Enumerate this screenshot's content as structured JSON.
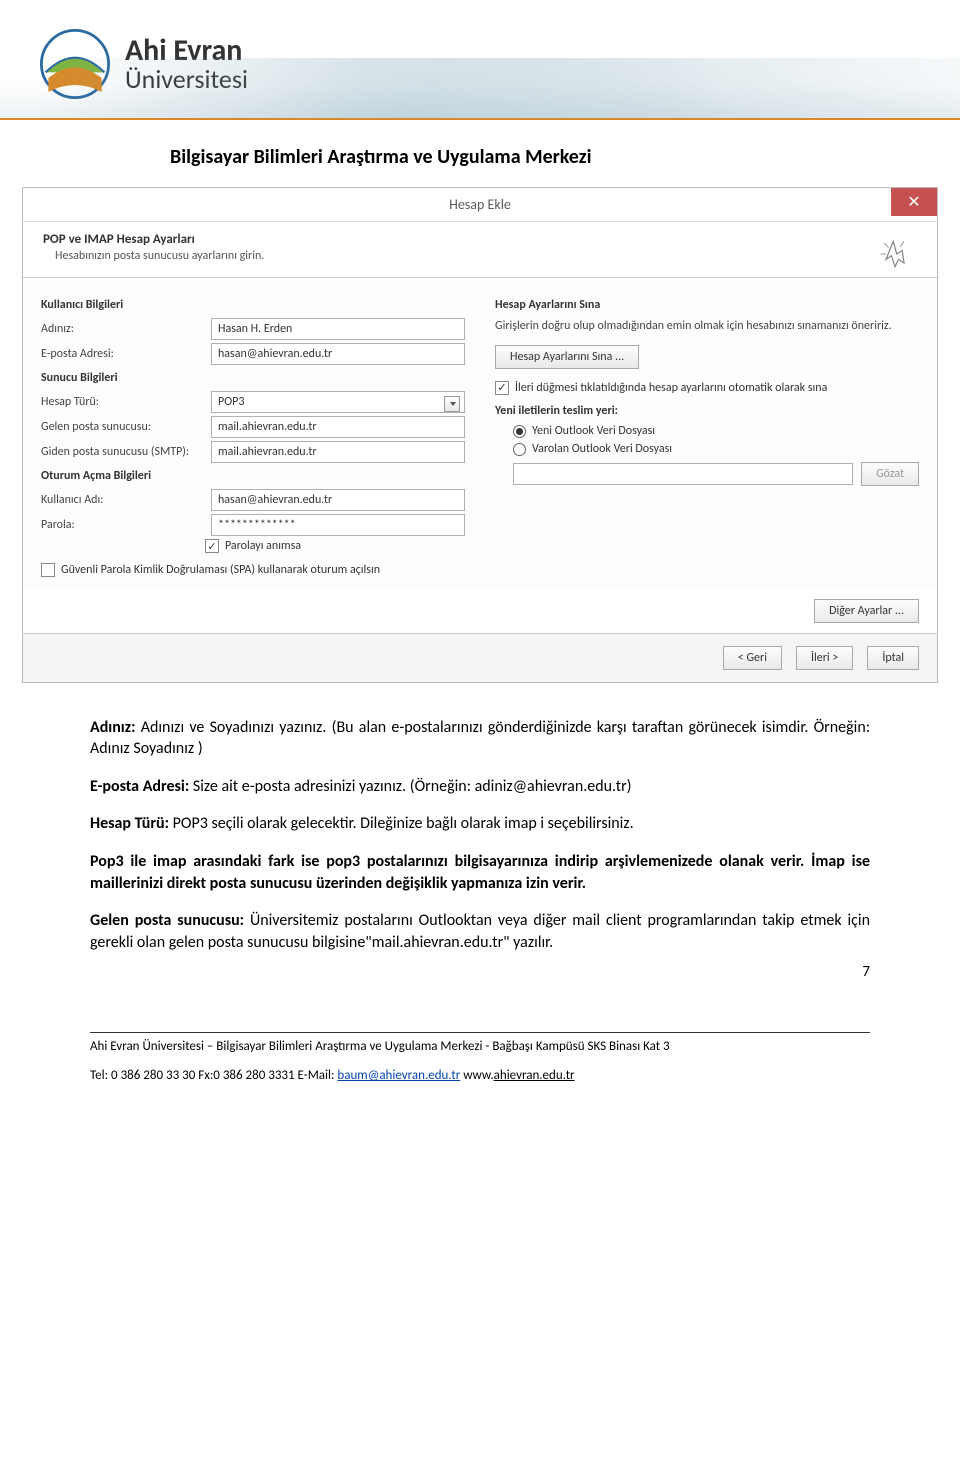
{
  "header": {
    "uni_name": "Ahi Evran",
    "uni_sub": "Üniversitesi",
    "dept_heading": "Bilgisayar Bilimleri Araştırma ve Uygulama Merkezi"
  },
  "dialog": {
    "title": "Hesap Ekle",
    "sub_title": "POP ve IMAP Hesap Ayarları",
    "sub_desc": "Hesabınızın posta sunucusu ayarlarını girin.",
    "sections": {
      "user_info": "Kullanıcı Bilgileri",
      "server_info": "Sunucu Bilgileri",
      "login_info": "Oturum Açma Bilgileri",
      "test": "Hesap Ayarlarını Sına",
      "deliver": "Yeni iletilerin teslim yeri:"
    },
    "labels": {
      "name": "Adınız:",
      "email": "E-posta Adresi:",
      "acct_type": "Hesap Türü:",
      "incoming": "Gelen posta sunucusu:",
      "outgoing": "Giden posta sunucusu (SMTP):",
      "username": "Kullanıcı Adı:",
      "password": "Parola:",
      "remember_pw": "Parolayı anımsa",
      "spa": "Güvenli Parola Kimlik Doğrulaması (SPA) kullanarak oturum açılsın",
      "test_note": "Girişlerin doğru olup olmadığından emin olmak için hesabınızı sınamanızı öneririz.",
      "test_btn": "Hesap Ayarlarını Sına ...",
      "auto_test": "İleri düğmesi tıklatıldığında hesap ayarlarını otomatik olarak sına",
      "new_pst": "Yeni Outlook Veri Dosyası",
      "exist_pst": "Varolan Outlook Veri Dosyası",
      "browse": "Gözat",
      "more": "Diğer Ayarlar ...",
      "back": "< Geri",
      "next": "İleri >",
      "cancel": "İptal"
    },
    "values": {
      "name": "Hasan H. Erden",
      "email": "hasan@ahievran.edu.tr",
      "acct_type": "POP3",
      "incoming": "mail.ahievran.edu.tr",
      "outgoing": "mail.ahievran.edu.tr",
      "username": "hasan@ahievran.edu.tr",
      "password": "*************"
    }
  },
  "body": {
    "p1a": "Adınız:",
    "p1b": " Adınızı ve Soyadınızı yazınız. (Bu alan e-postalarınızı gönderdiğinizde karşı taraftan görünecek isimdir. Örneğin: Adınız Soyadınız )",
    "p2a": "E-posta Adresi:",
    "p2b": " Size ait e-posta adresinizi yazınız. (Örneğin: adiniz@ahievran.edu.tr)",
    "p3a": "Hesap Türü:",
    "p3b": " POP3 seçili olarak gelecektir. Dileğinize bağlı olarak imap i seçebilirsiniz.",
    "p4": "Pop3 ile imap arasındaki fark ise pop3 postalarınızı bilgisayarınıza indirip arşivlemenizede olanak verir. İmap ise maillerinizi direkt posta sunucusu üzerinden değişiklik yapmanıza izin verir.",
    "p5a": "Gelen posta sunucusu:",
    "p5b": " Üniversitemiz postalarını Outlooktan veya diğer mail client programlarından takip etmek için gerekli olan gelen posta sunucusu bilgisine\"mail.ahievran.edu.tr\" yazılır."
  },
  "page_number": "7",
  "footer": {
    "line1": "Ahi Evran Üniversitesi – Bilgisayar Bilimleri Araştırma ve Uygulama Merkezi - Bağbaşı Kampüsü SKS Binası Kat 3",
    "tel_label": "Tel: 0 386 280 33 30 Fx:0 386 280 3331   E-Mail: ",
    "email": "baum@ahievran.edu.tr",
    "site_prefix": "  www.",
    "site": "ahievran.edu.tr"
  }
}
